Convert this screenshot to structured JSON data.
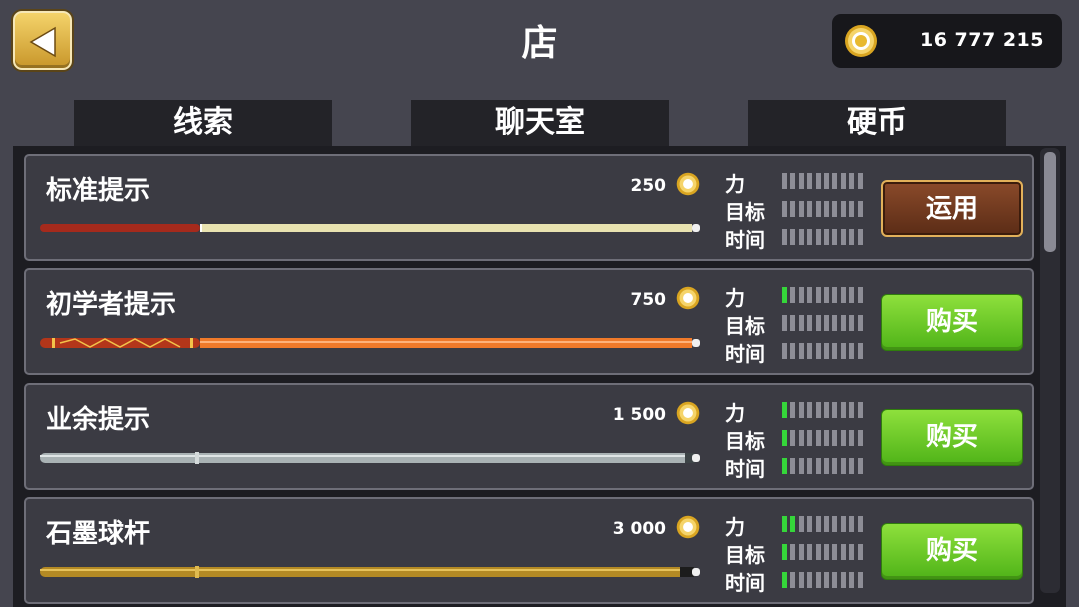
{
  "header": {
    "title": "店",
    "coins": "16 777 215"
  },
  "tabs": [
    {
      "label": "线索"
    },
    {
      "label": "聊天室"
    },
    {
      "label": "硬币"
    }
  ],
  "stat_labels": {
    "power": "力",
    "aim": "目标",
    "time": "时间"
  },
  "cues": [
    {
      "name": "标准提示",
      "price": "250",
      "power": 0,
      "aim": 0,
      "time": 0,
      "action": "运用",
      "action_type": "apply"
    },
    {
      "name": "初学者提示",
      "price": "750",
      "power": 1,
      "aim": 0,
      "time": 0,
      "action": "购买",
      "action_type": "buy"
    },
    {
      "name": "业余提示",
      "price": "1 500",
      "power": 1,
      "aim": 1,
      "time": 1,
      "action": "购买",
      "action_type": "buy"
    },
    {
      "name": "石墨球杆",
      "price": "3 000",
      "power": 2,
      "aim": 1,
      "time": 1,
      "action": "购买",
      "action_type": "buy"
    }
  ],
  "stat_segments_total": 10,
  "colors": {
    "background": "#45454f",
    "panel": "#1d1d22",
    "row": "#3b3b43",
    "stat_on": "#35d63a",
    "stat_off": "#8d8d96",
    "buy_button": "#6cc927",
    "apply_button": "#7a3f22",
    "back_button": "#e3b545"
  },
  "icons": {
    "back": "back-arrow-icon",
    "coin": "coin-icon"
  }
}
